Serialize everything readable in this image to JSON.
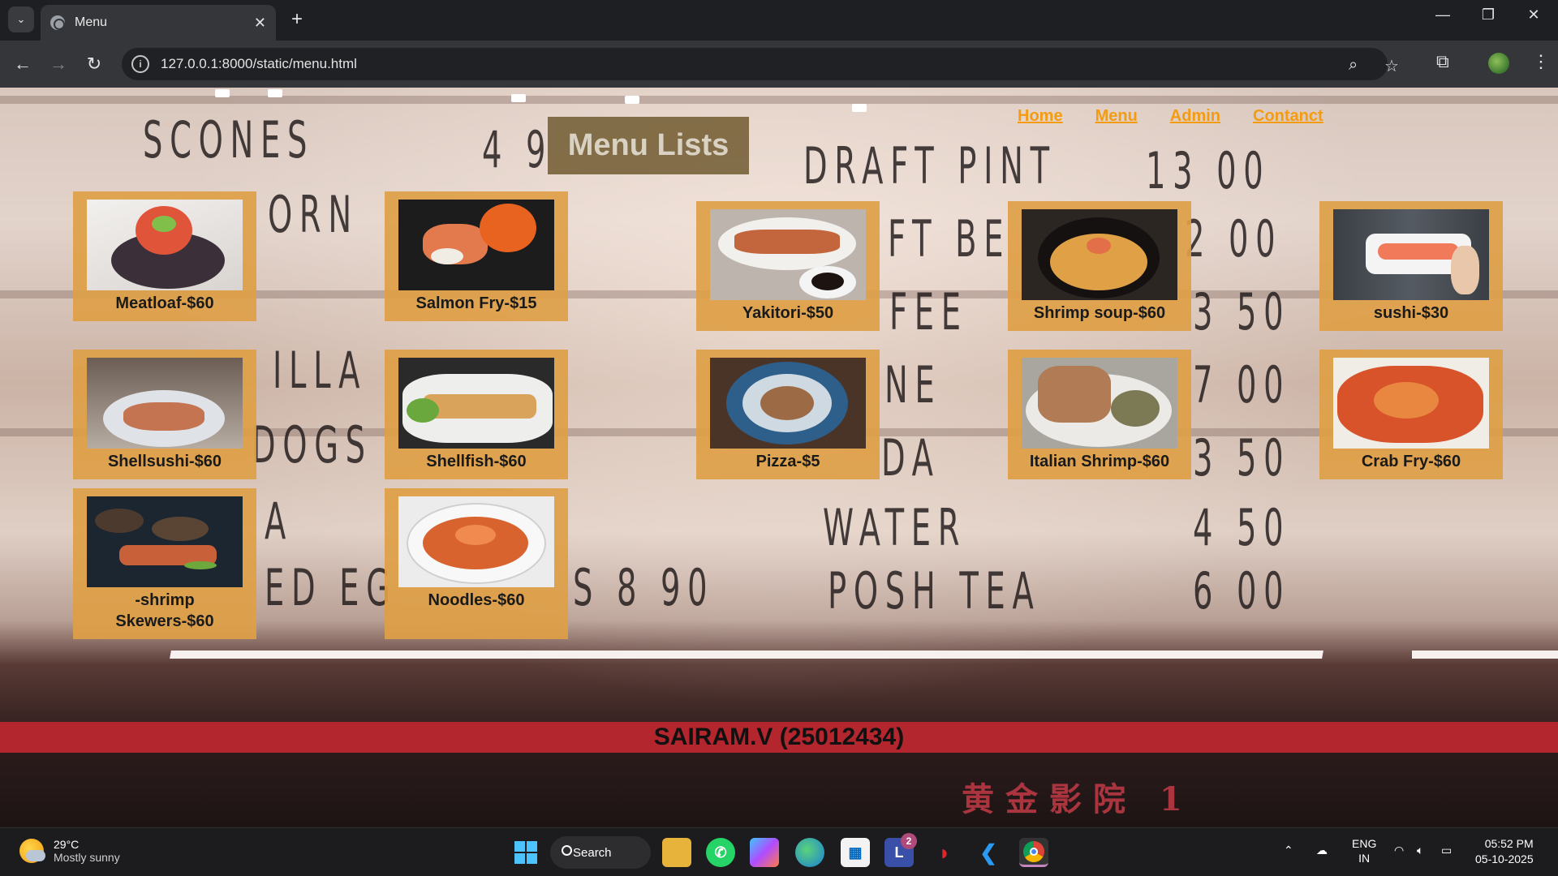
{
  "browser": {
    "tab_title": "Menu",
    "url": "127.0.0.1:8000/static/menu.html"
  },
  "page": {
    "title": "Menu Lists",
    "nav": [
      "Home",
      "Menu",
      "Admin",
      "Contanct"
    ],
    "items": [
      {
        "name": "Meatloaf-$60"
      },
      {
        "name": "Salmon Fry-$15"
      },
      {
        "name": "Yakitori-$50"
      },
      {
        "name": "Shrimp soup-$60"
      },
      {
        "name": "sushi-$30"
      },
      {
        "name": "Shellsushi-$60"
      },
      {
        "name": "Shellfish-$60"
      },
      {
        "name": "Pizza-$5"
      },
      {
        "name": "Italian Shrimp-$60"
      },
      {
        "name": "Crab Fry-$60"
      },
      {
        "name": "-shrimp Skewers-$60"
      },
      {
        "name": "Noodles-$60"
      }
    ],
    "footer": "SAIRAM.V (25012434)",
    "background_board": [
      "SCONES",
      "4 9",
      "DRAFT PINT",
      "13 00",
      "ORN",
      "FT BE",
      "2 00",
      "FEE",
      "3 50",
      "ILLA",
      "NE",
      "7 00",
      "DOGS",
      "DA",
      "3 50",
      "A",
      "WATER",
      "4 50",
      "ED EG",
      "S 8 90",
      "POSH TEA",
      "6 00"
    ],
    "neon_sign": "黄金影院 1",
    "colors": {
      "card": "#dea046",
      "nav_link": "#f39c12",
      "footer_bar": "#b3262e"
    }
  },
  "taskbar": {
    "temperature": "29°C",
    "condition": "Mostly sunny",
    "search_label": "Search",
    "notification_count": "2",
    "language": "ENG",
    "region": "IN",
    "time": "05:52 PM",
    "date": "05-10-2025"
  }
}
